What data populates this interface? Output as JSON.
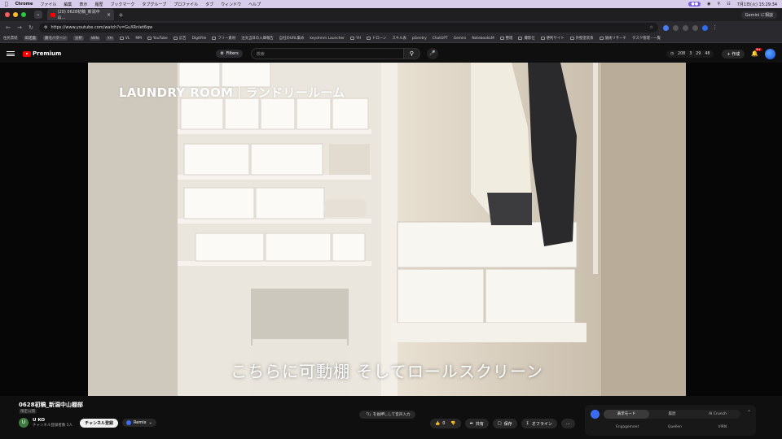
{
  "mac_menubar": {
    "app": "Chrome",
    "menus": [
      "ファイル",
      "編集",
      "表示",
      "履歴",
      "ブックマーク",
      "タブグループ",
      "プロファイル",
      "タブ",
      "ウィンドウ",
      "ヘルプ"
    ],
    "clock": "7月1日(火) 15:29:34"
  },
  "browser": {
    "tab_title": "(20) 0628初稿_新潟中山…",
    "new_tab": "+",
    "url": "https://www.youtube.com/watch?v=GuXRnIet6qw",
    "gemini_label": "Gemini に相談",
    "bookmarks": [
      "住民票続",
      "ID定義",
      "腸モバターン",
      "分析",
      "WIN",
      "YH",
      "VL",
      "MM",
      "YouTube",
      "広告",
      "DigitFile",
      "フリー素材",
      "注文当日の入庫報告",
      "自社のURL集め",
      "keydrmm Launcher",
      "YH",
      "ドローン",
      "スキル表",
      "pGentry",
      "ChatGPT",
      "Gemini",
      "NotebookLM",
      "整理",
      "撮影仕",
      "便利サイト",
      "外壁塗装系",
      "施術リサーチ",
      "タスク管理・一覧"
    ]
  },
  "youtube": {
    "logo_text": "Premium",
    "filters_label": "Filters",
    "search_placeholder": "検索",
    "stats": [
      "208",
      "3",
      "29",
      "48"
    ],
    "create_label": "作成",
    "notification_count": "9+"
  },
  "video": {
    "title_overlay": "LAUNDRY ROOM｜ランドリールーム",
    "subtitle": "こちらに可動棚 そしてロールスクリーン"
  },
  "info": {
    "video_title": "0628初稿_新潟中山棚部",
    "visibility": "限定公開",
    "channel_initial": "U",
    "channel_name": "U KO",
    "channel_subs": "チャンネル登録者数 5人",
    "subscribe_label": "チャンネル登録",
    "remix_label": "Remix",
    "speak_hint": "「/」を長押しして音声入力",
    "like_count": "0",
    "share_label": "共有",
    "save_label": "保存",
    "offline_label": "オフライン",
    "more_label": "…"
  },
  "right_panel": {
    "tabs": [
      "表示モード",
      "履歴",
      "AI Crunch"
    ],
    "labels": [
      "Engagement",
      "Quellen",
      "VIRN"
    ]
  }
}
